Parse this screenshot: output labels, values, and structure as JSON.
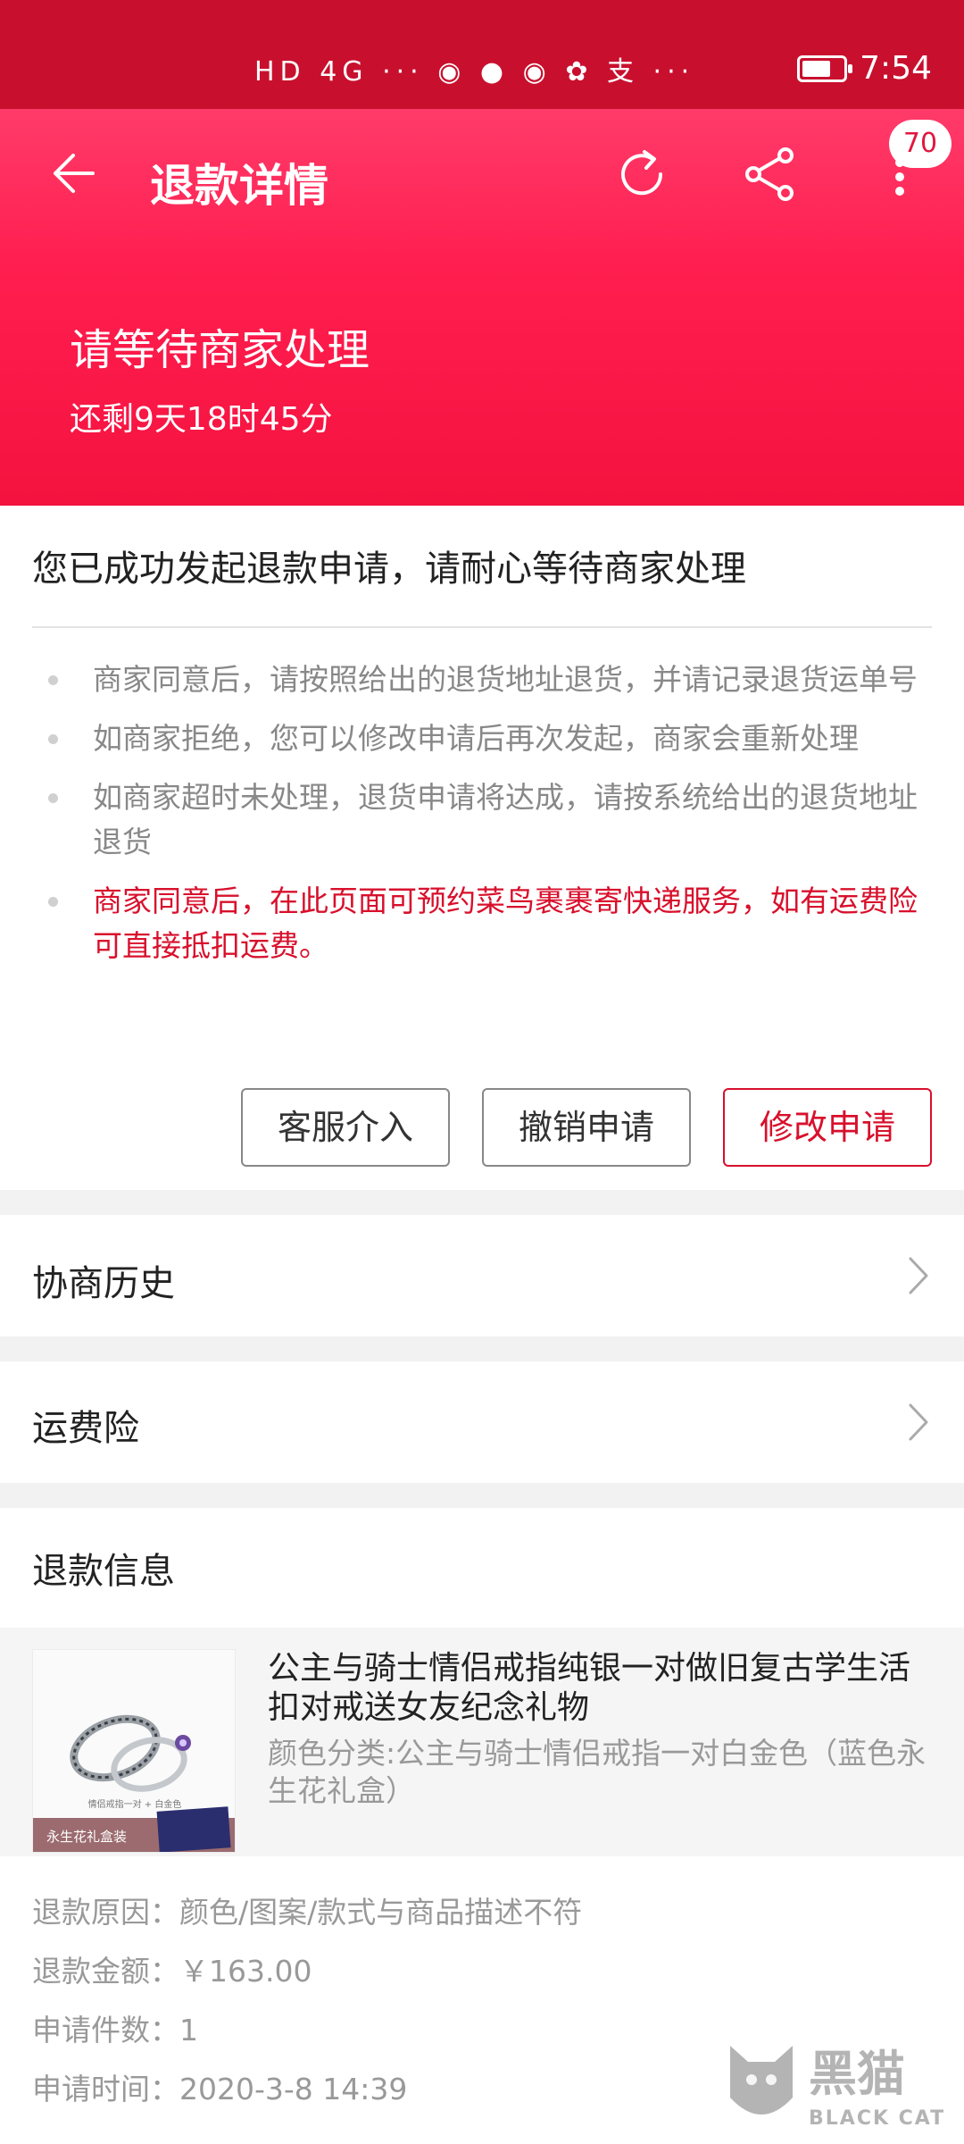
{
  "statusbar": {
    "time": "7:54",
    "icons": "HD 4G ··· ◉ ● ◉ ✿ 支 ···",
    "battery_level": 0.7
  },
  "header": {
    "title": "退款详情",
    "badge": "70"
  },
  "status": {
    "title": "请等待商家处理",
    "countdown": "还剩9天18时45分"
  },
  "notice": {
    "headline": "您已成功发起退款申请，请耐心等待商家处理",
    "tips": [
      "商家同意后，请按照给出的退货地址退货，并请记录退货运单号",
      "如商家拒绝，您可以修改申请后再次发起，商家会重新处理",
      "如商家超时未处理，退货申请将达成，请按系统给出的退货地址退货",
      "商家同意后，在此页面可预约菜鸟裹裹寄快递服务，如有运费险可直接抵扣运费。"
    ]
  },
  "buttons": {
    "service": "客服介入",
    "cancel": "撤销申请",
    "modify": "修改申请"
  },
  "rows": {
    "history": "协商历史",
    "insurance": "运费险"
  },
  "refund_info": {
    "label": "退款信息",
    "product_name": "公主与骑士情侣戒指纯银一对做旧复古学生活扣对戒送女友纪念礼物",
    "product_spec": "颜色分类:公主与骑士情侣戒指一对白金色（蓝色永生花礼盒）",
    "thumb_caption": "永生花礼盒装",
    "thumb_sub": "情侣戒指一对 + 白金色",
    "reason": "退款原因：颜色/图案/款式与商品描述不符",
    "amount": "退款金额：￥163.00",
    "count": "申请件数：1",
    "time": "申请时间：2020-3-8 14:39"
  },
  "watermark": {
    "cn": "黑猫",
    "en": "BLACK CAT"
  },
  "colors": {
    "brand": "#ff1e4f",
    "statusbar": "#c8102e",
    "accent_red": "#d8102c"
  }
}
